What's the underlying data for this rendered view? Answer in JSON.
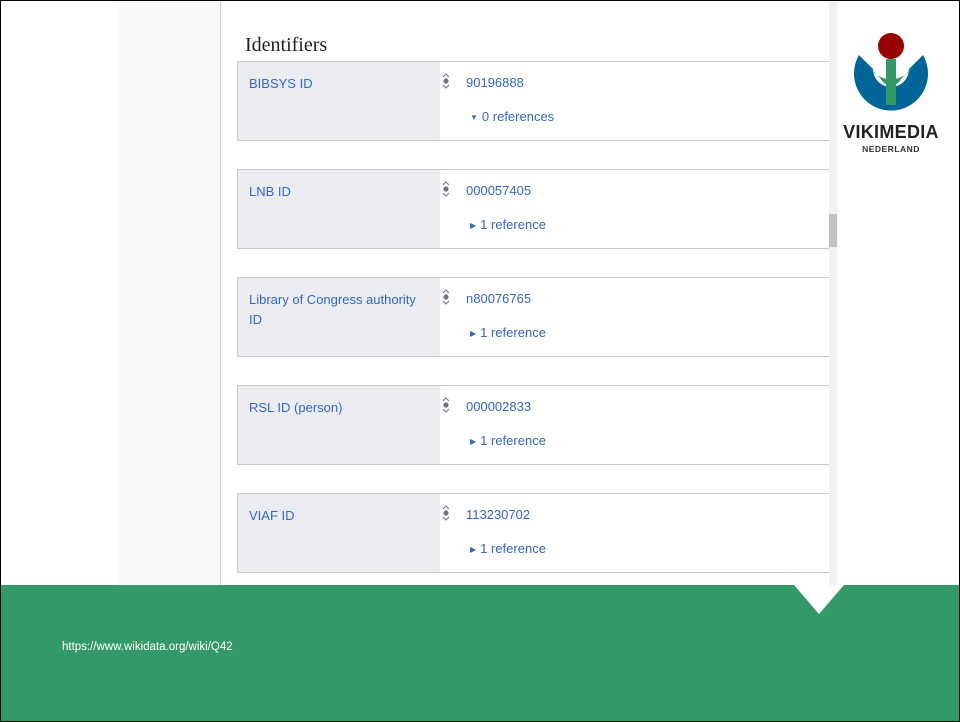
{
  "page": {
    "source_url": "https://www.wikidata.org/wiki/Q42"
  },
  "section": {
    "title": "Identifiers"
  },
  "claims": [
    {
      "property": "BIBSYS ID",
      "value": "90196888",
      "references": "0 references",
      "expanded": true
    },
    {
      "property": "LNB ID",
      "value": "000057405",
      "references": "1 reference",
      "expanded": false
    },
    {
      "property": "Library of Congress authority ID",
      "value": "n80076765",
      "references": "1 reference",
      "expanded": false
    },
    {
      "property": "RSL ID (person)",
      "value": "000002833",
      "references": "1 reference",
      "expanded": false
    },
    {
      "property": "VIAF ID",
      "value": "113230702",
      "references": "1 reference",
      "expanded": false
    }
  ],
  "logo": {
    "name": "wikimedia-logo",
    "word": "VIKIMEDIA",
    "sub": "NEDERLAND",
    "colors": {
      "blue": "#006699",
      "green": "#339966",
      "red": "#990000"
    }
  },
  "colors": {
    "link": "#3366cc",
    "footer": "#339966",
    "property_bg": "#eaecf0"
  }
}
